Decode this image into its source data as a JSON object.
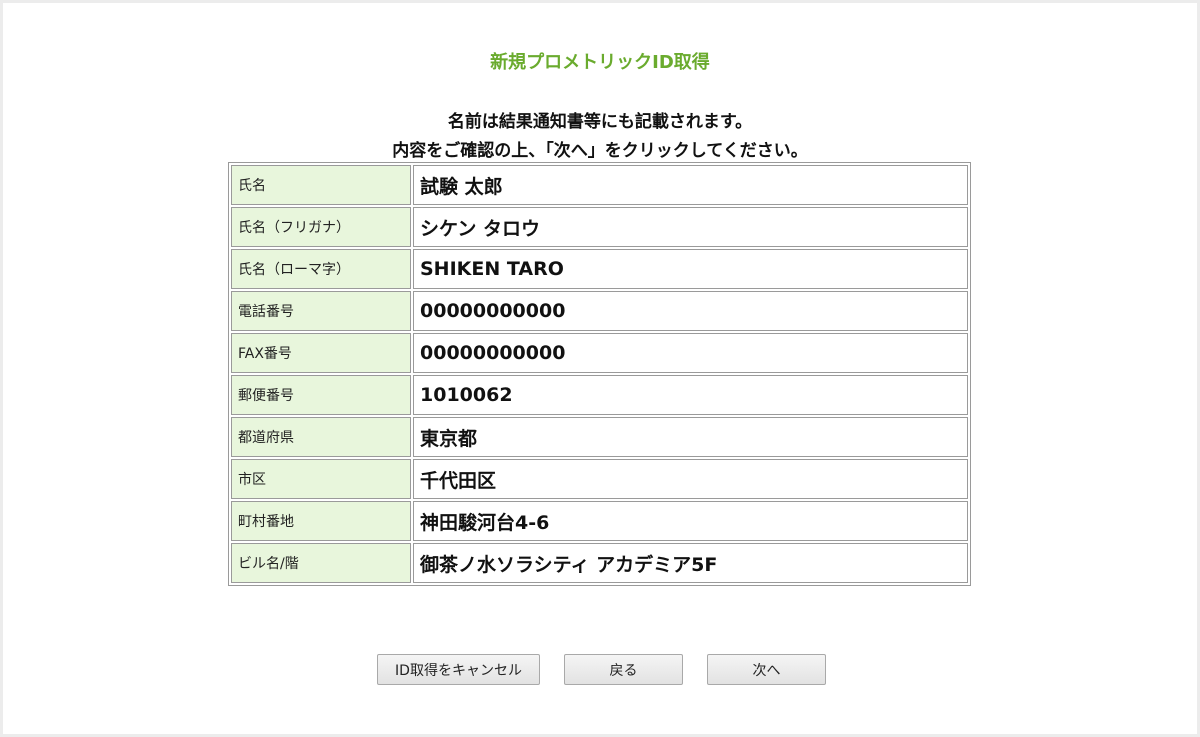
{
  "page": {
    "title": "新規プロメトリックID取得",
    "notice_line1": "名前は結果通知書等にも記載されます。",
    "notice_line2": "内容をご確認の上、「次へ」をクリックしてください。"
  },
  "rows": [
    {
      "label": "氏名",
      "value": "試験 太郎"
    },
    {
      "label": "氏名（フリガナ）",
      "value": "シケン タロウ"
    },
    {
      "label": "氏名（ローマ字）",
      "value": "SHIKEN TARO"
    },
    {
      "label": "電話番号",
      "value": "00000000000"
    },
    {
      "label": "FAX番号",
      "value": "00000000000"
    },
    {
      "label": "郵便番号",
      "value": "1010062"
    },
    {
      "label": "都道府県",
      "value": "東京都"
    },
    {
      "label": "市区",
      "value": "千代田区"
    },
    {
      "label": "町村番地",
      "value": "神田駿河台4-6"
    },
    {
      "label": "ビル名/階",
      "value": "御茶ノ水ソラシティ アカデミア5F"
    }
  ],
  "buttons": {
    "cancel": "ID取得をキャンセル",
    "back": "戻る",
    "next": "次へ"
  },
  "colors": {
    "title": "#6aab2e",
    "label_background": "#e8f6dc"
  }
}
